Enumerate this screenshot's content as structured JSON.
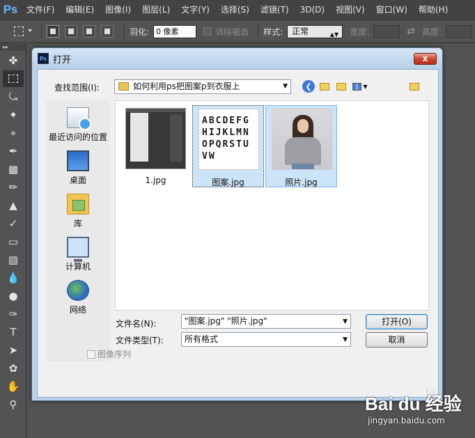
{
  "app": {
    "logo": "Ps",
    "menu": [
      "文件(F)",
      "编辑(E)",
      "图像(I)",
      "图层(L)",
      "文字(Y)",
      "选择(S)",
      "滤镜(T)",
      "3D(D)",
      "视图(V)",
      "窗口(W)",
      "帮助(H)"
    ]
  },
  "options_bar": {
    "feather_label": "羽化:",
    "feather_value": "0 像素",
    "antialias_label": "消除锯齿",
    "style_label": "样式:",
    "style_value": "正常",
    "width_label": "宽度:",
    "height_label": "高度:"
  },
  "dialog": {
    "title_icon": "Ps",
    "title": "打开",
    "close_glyph": "x",
    "lookin_label": "查找范围(I):",
    "lookin_value": "如何利用ps把图案p到衣服上",
    "places": [
      "最近访问的位置",
      "桌面",
      "库",
      "计算机",
      "网络"
    ],
    "files": [
      {
        "name": "1.jpg",
        "selected": false
      },
      {
        "name": "图案.jpg",
        "selected": true
      },
      {
        "name": "照片.jpg",
        "selected": true
      }
    ],
    "pattern_letters": "ABCDEFGHIJKLMNOPQRSTUVW",
    "filename_label": "文件名(N):",
    "filename_value": "\"图案.jpg\" \"照片.jpg\"",
    "filetype_label": "文件类型(T):",
    "filetype_value": "所有格式",
    "open_button": "打开(O)",
    "cancel_button": "取消",
    "sequence_label": "图像序列"
  },
  "watermark": {
    "logo": "Bai du 经验",
    "url": "jingyan.baidu.com"
  },
  "colors": {
    "ps_dark": "#535353",
    "dialog_frame": "#bcd2ea",
    "selection": "#cce4f7",
    "close_red": "#c9462f"
  }
}
